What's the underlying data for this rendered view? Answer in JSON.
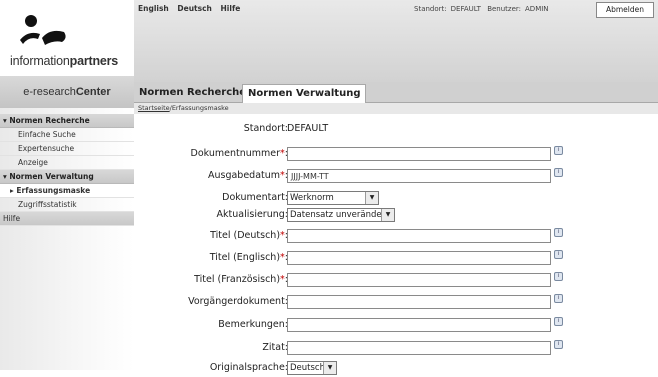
{
  "brand": {
    "name_prefix": "information",
    "name_suffix": "partners",
    "center_prefix": "e-research",
    "center_suffix": "Center"
  },
  "topbar": {
    "languages": [
      "English",
      "Deutsch",
      "Hilfe"
    ],
    "standort_label": "Standort:",
    "standort_value": "DEFAULT",
    "benutzer_label": "Benutzer:",
    "benutzer_value": "ADMIN",
    "logout_label": "Abmelden"
  },
  "tabs": [
    "Normen Recherche",
    "Normen Verwaltung"
  ],
  "breadcrumb": {
    "home": "Startseite",
    "current": "/Erfassungsmaske"
  },
  "nav": {
    "section1": "▾ Normen Recherche",
    "section1_items": [
      "Einfache Suche",
      "Expertensuche",
      "Anzeige"
    ],
    "section2": "▾ Normen Verwaltung",
    "active": "▸ Erfassungsmaske",
    "section2_items": [
      "Zugriffsstatistik"
    ],
    "hilfe": "Hilfe"
  },
  "form": {
    "standort_label": "Standort:",
    "standort_value": "DEFAULT",
    "dokumentnummer_label": "Dokumentnummer",
    "dokumentnummer_value": "",
    "ausgabedatum_label": "Ausgabedatum",
    "ausgabedatum_value": "JJJJ-MM-TT",
    "dokumentart_label": "Dokumentart:",
    "dokumentart_value": "Werknorm",
    "aktualisierung_label": "Aktualisierung:",
    "aktualisierung_value": "Datensatz unverändert",
    "titel_de_label": "Titel (Deutsch)",
    "titel_en_label": "Titel (Englisch)",
    "titel_fr_label": "Titel (Französisch)",
    "vorgaenger_label": "Vorgängerdokument:",
    "bemerkungen_label": "Bemerkungen:",
    "zitat_label": "Zitat:",
    "originalsprache_label": "Originalsprache:",
    "originalsprache_value": "Deutsch",
    "required_mark": "*",
    "colon": ":"
  }
}
